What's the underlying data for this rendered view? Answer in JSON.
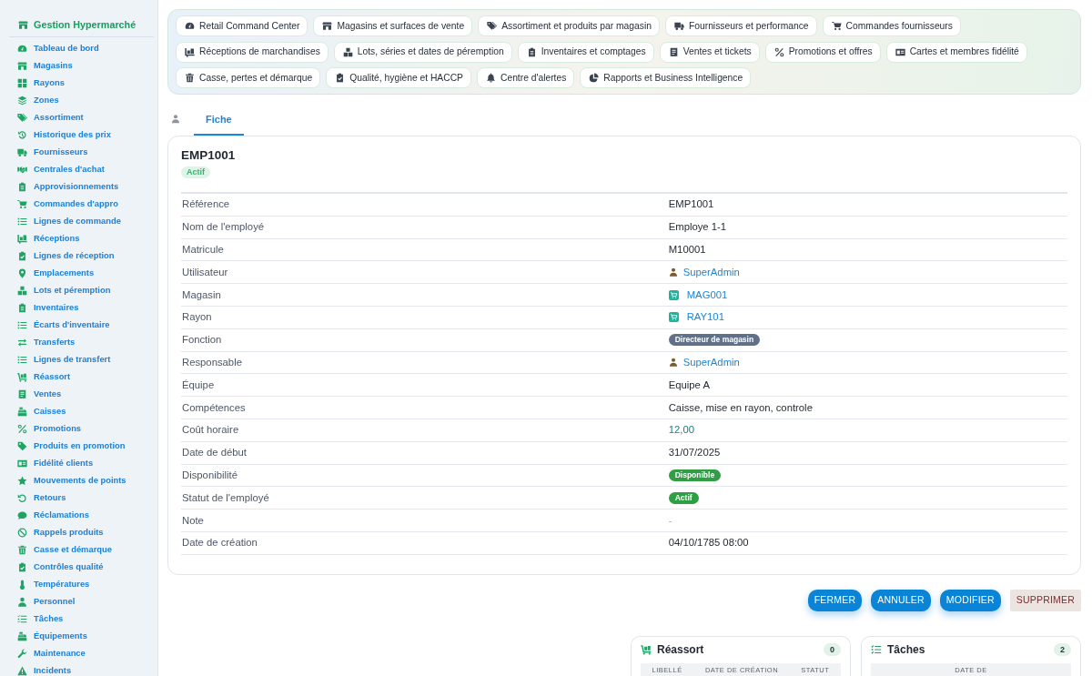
{
  "sidebar": {
    "brand": "Gestion Hypermarché",
    "items": [
      "Tableau de bord",
      "Magasins",
      "Rayons",
      "Zones",
      "Assortiment",
      "Historique des prix",
      "Fournisseurs",
      "Centrales d'achat",
      "Approvisionnements",
      "Commandes d'appro",
      "Lignes de commande",
      "Réceptions",
      "Lignes de réception",
      "Emplacements",
      "Lots et péremption",
      "Inventaires",
      "Écarts d'inventaire",
      "Transferts",
      "Lignes de transfert",
      "Réassort",
      "Ventes",
      "Caisses",
      "Promotions",
      "Produits en promotion",
      "Fidélité clients",
      "Mouvements de points",
      "Retours",
      "Réclamations",
      "Rappels produits",
      "Casse et démarque",
      "Contrôles qualité",
      "Températures",
      "Personnel",
      "Tâches",
      "Équipements",
      "Maintenance",
      "Incidents"
    ]
  },
  "modules": [
    "Retail Command Center",
    "Magasins et surfaces de vente",
    "Assortiment et produits par magasin",
    "Fournisseurs et performance",
    "Commandes fournisseurs",
    "Réceptions de marchandises",
    "Lots, séries et dates de péremption",
    "Inventaires et comptages",
    "Ventes et tickets",
    "Promotions et offres",
    "Cartes et membres fidélité",
    "Casse, pertes et démarque",
    "Qualité, hygiène et HACCP",
    "Centre d'alertes",
    "Rapports et Business Intelligence"
  ],
  "tabs": [
    {
      "kind": "icon",
      "selected": false
    },
    {
      "kind": "text",
      "label": "Fiche",
      "selected": true
    }
  ],
  "record": {
    "title": "EMP1001",
    "status": "Actif",
    "fields": [
      {
        "label": "Référence",
        "kind": "text",
        "value": "EMP1001"
      },
      {
        "label": "Nom de l'employé",
        "kind": "text",
        "value": "Employe 1-1"
      },
      {
        "label": "Matricule",
        "kind": "text",
        "value": "M10001"
      },
      {
        "label": "Utilisateur",
        "kind": "user",
        "value": "SuperAdmin"
      },
      {
        "label": "Magasin",
        "kind": "shop",
        "value": "MAG001"
      },
      {
        "label": "Rayon",
        "kind": "shop",
        "value": "RAY101"
      },
      {
        "label": "Fonction",
        "kind": "badge",
        "value": "Directeur de magasin",
        "color": "#617089"
      },
      {
        "label": "Responsable",
        "kind": "user",
        "value": "SuperAdmin"
      },
      {
        "label": "Équipe",
        "kind": "text",
        "value": "Equipe A"
      },
      {
        "label": "Compétences",
        "kind": "text",
        "value": "Caisse, mise en rayon, controle"
      },
      {
        "label": "Coût horaire",
        "kind": "amount",
        "value": "12,00"
      },
      {
        "label": "Date de début",
        "kind": "text",
        "value": "31/07/2025"
      },
      {
        "label": "Disponibilité",
        "kind": "badge",
        "value": "Disponible",
        "color": "#2f9e44"
      },
      {
        "label": "Statut de l'employé",
        "kind": "badge",
        "value": "Actif",
        "color": "#2f9e44"
      },
      {
        "label": "Note",
        "kind": "empty",
        "value": "-"
      },
      {
        "label": "Date de création",
        "kind": "text",
        "value": "04/10/1785 08:00"
      }
    ]
  },
  "actions": [
    {
      "label": "FERMER",
      "kind": "primary"
    },
    {
      "label": "ANNULER",
      "kind": "primary"
    },
    {
      "label": "MODIFIER",
      "kind": "primary"
    },
    {
      "label": "SUPPRIMER",
      "kind": "danger"
    }
  ],
  "related": [
    {
      "title": "Réassort",
      "count": "0",
      "columns": [
        "LIBELLÉ",
        "DATE DE CRÉATION",
        "STATUT"
      ]
    },
    {
      "title": "Tâches",
      "count": "2",
      "columns": [
        "DATE DE"
      ]
    }
  ]
}
